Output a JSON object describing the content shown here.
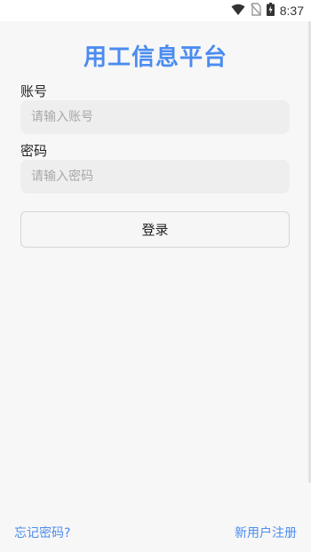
{
  "status_bar": {
    "time": "8:37",
    "icons": [
      "wifi-icon",
      "no-sim-icon",
      "battery-charging-icon"
    ]
  },
  "app": {
    "title": "用工信息平台",
    "accent_color": "#4b8cf0"
  },
  "form": {
    "account_label": "账号",
    "account_placeholder": "请输入账号",
    "account_value": "",
    "password_label": "密码",
    "password_placeholder": "请输入密码",
    "password_value": "",
    "login_label": "登录"
  },
  "footer": {
    "forgot_password": "忘记密码?",
    "register": "新用户注册"
  }
}
